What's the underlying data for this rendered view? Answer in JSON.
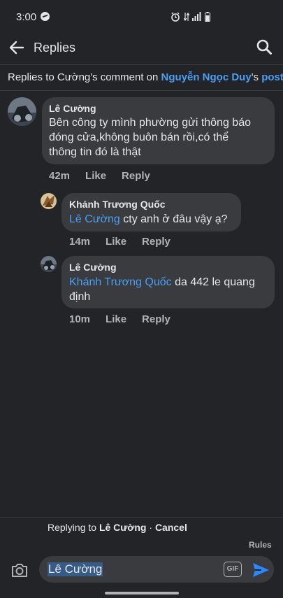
{
  "status_bar": {
    "time": "3:00"
  },
  "header": {
    "title": "Replies"
  },
  "context": {
    "prefix": "Replies to Cường's comment on ",
    "page_name": "Nguyễn Ngọc Duy",
    "suffix": "'s ",
    "post_link": "post"
  },
  "comments": [
    {
      "author": "Lê Cường",
      "text_lines": [
        "Bên công ty mình phường gửi thông báo",
        "đóng cửa,không buôn bán rồi,có thể",
        "thông tin đó là thật"
      ],
      "time": "42m",
      "like": "Like",
      "reply": "Reply"
    },
    {
      "author": "Khánh Trương Quốc",
      "mention": "Lê Cường",
      "text": " cty anh ở đâu vậy ạ?",
      "time": "14m",
      "like": "Like",
      "reply": "Reply"
    },
    {
      "author": "Lê Cường",
      "mention": "Khánh Trương Quốc",
      "text_line1": " da 442 le quang",
      "text_line2": "định",
      "time": "10m",
      "like": "Like",
      "reply": "Reply"
    }
  ],
  "composer": {
    "replying_prefix": "Replying to ",
    "replying_name": "Lê Cường",
    "separator": " · ",
    "cancel": "Cancel",
    "rules": "Rules",
    "input_value": "Lê Cường",
    "gif_label": "GIF"
  },
  "colors": {
    "background": "#232427",
    "bubble": "#3a3b3e",
    "link": "#4a9ff5"
  }
}
